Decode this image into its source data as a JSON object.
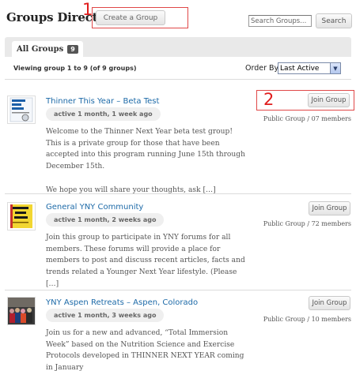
{
  "header": {
    "title": "Groups Directory",
    "create_label": "Create a Group",
    "marker_1": "1",
    "marker_2": "2",
    "search_placeholder": "Search Groups...",
    "search_label": "Search"
  },
  "tabs": {
    "all_label": "All Groups",
    "all_count": "9"
  },
  "listing": {
    "viewing_text": "Viewing group 1 to 9 (of 9 groups)",
    "order_by_label": "Order By:",
    "order_by_value": "Last Active"
  },
  "groups": [
    {
      "title": "Thinner This Year – Beta Test",
      "active": "active 1 month, 1 week ago",
      "description": "Welcome to the Thinner Next Year beta test group! This is a private group for those that have been accepted into this program running June 15th through December 15th. We hope you will share your thoughts, ask […]",
      "desc_p1": "Welcome to the Thinner Next Year beta test group! This is a private group for those that have been accepted into this program running June 15th through December 15th.",
      "desc_p2": "We hope you will share your thoughts, ask […]",
      "join_label": "Join Group",
      "meta": "Public Group / 07 members",
      "avatar_icon": "thinner-book-cover-icon"
    },
    {
      "title": "General YNY Community",
      "active": "active 1 month, 2 weeks ago",
      "description": "Join this group to participate in YNY forums for all members. These forums will provide a place for members to post and discuss recent articles, facts and trends related a Younger Next Year lifestyle. (Please […]",
      "join_label": "Join Group",
      "meta": "Public Group / 72 members",
      "avatar_icon": "younger-book-cover-icon"
    },
    {
      "title": "YNY Aspen Retreats – Aspen, Colorado",
      "active": "active 1 month, 3 weeks ago",
      "description": "Join us for a new and advanced, “Total Immersion Week” based on the Nutrition Science and Exercise Protocols developed in THINNER NEXT YEAR coming in January",
      "join_label": "Join Group",
      "meta": "Public Group / 10 members",
      "avatar_icon": "group-photo-icon"
    }
  ],
  "colors": {
    "link": "#1d6aa8",
    "annotation_red": "#e01c1c"
  }
}
